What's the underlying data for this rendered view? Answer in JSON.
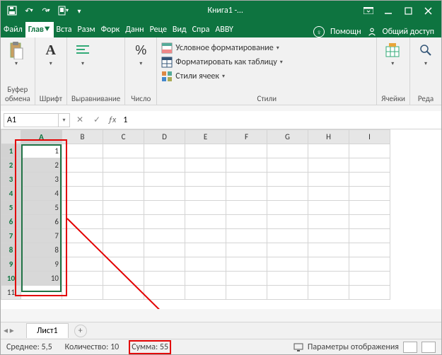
{
  "title": "Книга1 -…",
  "tabs": {
    "file": "Файл",
    "home": "Глав⯆",
    "insert": "Вста",
    "layout": "Разм",
    "formulas": "Форк",
    "data": "Данн",
    "review": "Реце",
    "view": "Вид",
    "help": "Спра",
    "abbyy": "ABBY"
  },
  "help_label": "Помощн",
  "share_label": "Общий доступ",
  "ribbon_groups": {
    "clipboard": "Буфер\nобмена",
    "font": "Шрифт",
    "align": "Выравнивание",
    "number": "Число",
    "styles": "Стили",
    "cells": "Ячейки",
    "edit": "Реда"
  },
  "style_items": {
    "cond": "Условное форматирование",
    "table": "Форматировать как таблицу",
    "cell": "Стили ячеек"
  },
  "namebox": "A1",
  "formula_value": "1",
  "columns": [
    "A",
    "B",
    "C",
    "D",
    "E",
    "F",
    "G",
    "H",
    "I"
  ],
  "rows": [
    1,
    2,
    3,
    4,
    5,
    6,
    7,
    8,
    9,
    10,
    11
  ],
  "data": {
    "1": "1",
    "2": "2",
    "3": "3",
    "4": "4",
    "5": "5",
    "6": "6",
    "7": "7",
    "8": "8",
    "9": "9",
    "10": "10"
  },
  "sheet": "Лист1",
  "status": {
    "avg_label": "Среднее:",
    "avg": "5,5",
    "count_label": "Количество:",
    "count": "10",
    "sum_label": "Сумма:",
    "sum": "55",
    "display_opts": "Параметры отображения"
  }
}
